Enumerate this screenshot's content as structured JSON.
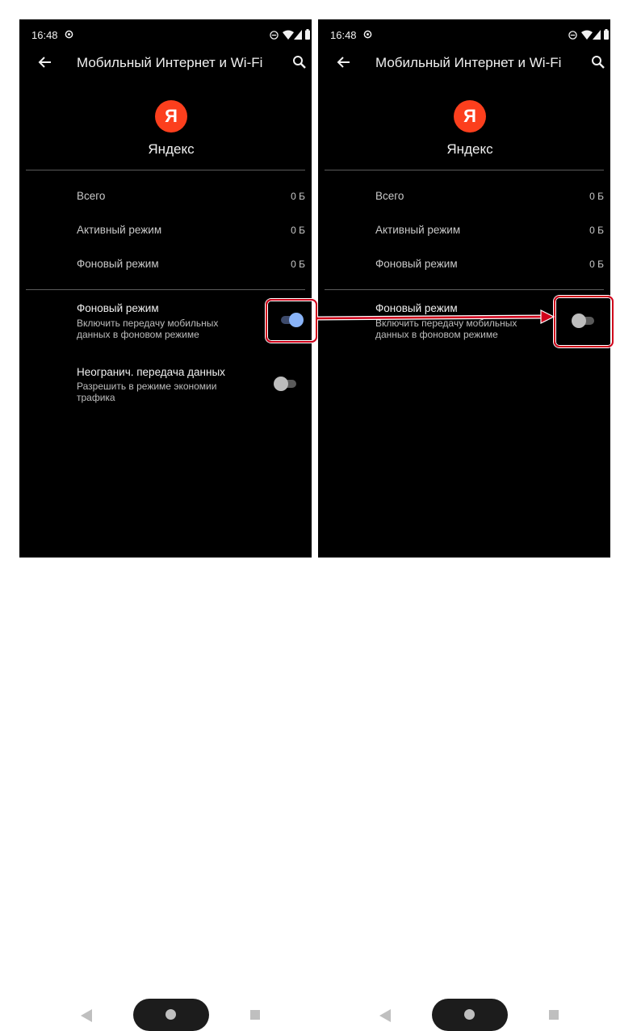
{
  "screens": [
    {
      "status_bar": {
        "time": "16:48",
        "icons": [
          "sync-icon",
          "dnd-icon",
          "wifi-icon",
          "signal-icon",
          "battery-icon"
        ]
      },
      "toolbar": {
        "title": "Мобильный Интернет и Wi-Fi",
        "back_icon": "arrow-left-icon",
        "search_icon": "search-icon"
      },
      "app": {
        "logo_letter": "Я",
        "name": "Яндекс",
        "logo_color": "#fc3f1d"
      },
      "usage": [
        {
          "label": "Всего",
          "value": "0 Б"
        },
        {
          "label": "Активный режим",
          "value": "0 Б"
        },
        {
          "label": "Фоновый режим",
          "value": "0 Б"
        }
      ],
      "settings": [
        {
          "title": "Фоновый режим",
          "description": "Включить передачу мобильных данных в фоновом режиме",
          "enabled": true
        },
        {
          "title": "Неогранич. передача данных",
          "description": "Разрешить в режиме экономии трафика",
          "enabled": false
        }
      ]
    },
    {
      "status_bar": {
        "time": "16:48",
        "icons": [
          "sync-icon",
          "dnd-icon",
          "wifi-icon",
          "signal-icon",
          "battery-icon"
        ]
      },
      "toolbar": {
        "title": "Мобильный Интернет и Wi-Fi",
        "back_icon": "arrow-left-icon",
        "search_icon": "search-icon"
      },
      "app": {
        "logo_letter": "Я",
        "name": "Яндекс",
        "logo_color": "#fc3f1d"
      },
      "usage": [
        {
          "label": "Всего",
          "value": "0 Б"
        },
        {
          "label": "Активный режим",
          "value": "0 Б"
        },
        {
          "label": "Фоновый режим",
          "value": "0 Б"
        }
      ],
      "settings": [
        {
          "title": "Фоновый режим",
          "description": "Включить передачу мобильных данных в фоновом режиме",
          "enabled": false
        }
      ]
    }
  ],
  "navigation": {
    "icons": [
      "nav-back-icon",
      "nav-home-icon",
      "nav-recents-icon"
    ]
  },
  "annotation": {
    "highlight_color": "#d0021b",
    "arrow_color": "#d0021b"
  }
}
